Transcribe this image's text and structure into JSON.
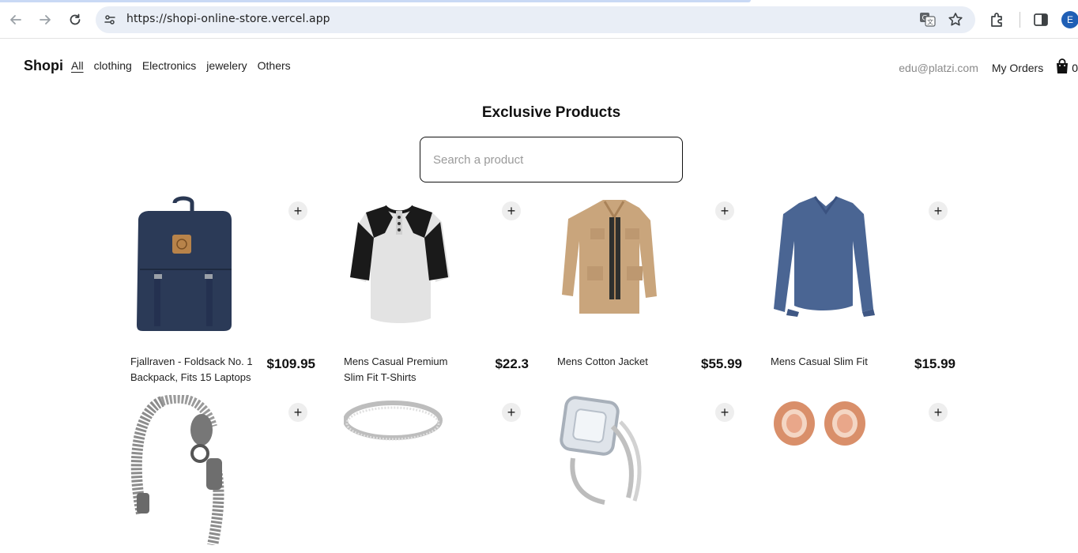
{
  "browser": {
    "url": "https://shopi-online-store.vercel.app",
    "profile_initial": "E",
    "icons": [
      "back-icon",
      "forward-icon",
      "reload-icon",
      "site-info-icon",
      "translate-icon",
      "bookmark-star-icon",
      "extensions-icon",
      "side-panel-icon"
    ]
  },
  "navbar": {
    "brand": "Shopi",
    "categories": [
      {
        "label": "All",
        "active": true
      },
      {
        "label": "clothing",
        "active": false
      },
      {
        "label": "Electronics",
        "active": false
      },
      {
        "label": "jewelery",
        "active": false
      },
      {
        "label": "Others",
        "active": false
      }
    ],
    "email": "edu@platzi.com",
    "orders_label": "My Orders",
    "cart_count": "0"
  },
  "main": {
    "title": "Exclusive Products",
    "search_placeholder": "Search a product"
  },
  "products": [
    {
      "name": "Fjallraven - Foldsack No. 1 Backpack, Fits 15 Laptops",
      "price": "$109.95",
      "image": "backpack"
    },
    {
      "name": "Mens Casual Premium Slim Fit T-Shirts",
      "price": "$22.3",
      "image": "raglan-tshirt"
    },
    {
      "name": "Mens Cotton Jacket",
      "price": "$55.99",
      "image": "cotton-jacket"
    },
    {
      "name": "Mens Casual Slim Fit",
      "price": "$15.99",
      "image": "blue-longsleeve"
    },
    {
      "name": "",
      "price": "",
      "image": "dragon-bracelet"
    },
    {
      "name": "",
      "price": "",
      "image": "silver-band-ring"
    },
    {
      "name": "",
      "price": "",
      "image": "diamond-ring-set"
    },
    {
      "name": "",
      "price": "",
      "image": "rose-gold-plugs"
    }
  ],
  "add_button_label": "+"
}
